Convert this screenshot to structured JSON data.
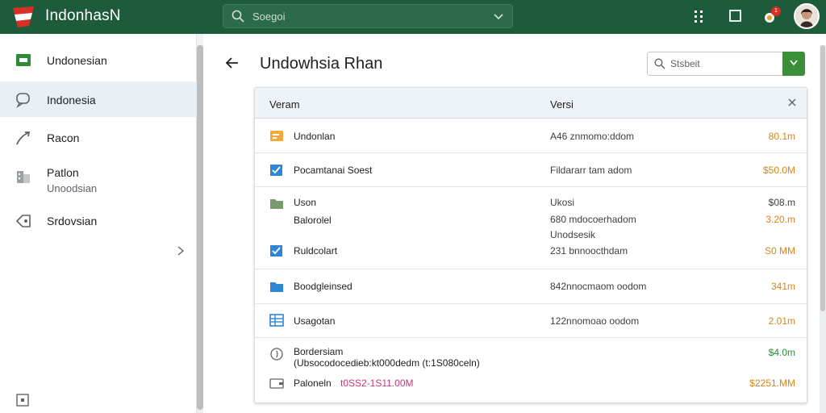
{
  "app": {
    "brand": "IndonhasN"
  },
  "search": {
    "placeholder": "Soegoi"
  },
  "topbar": {
    "notification_count": "1"
  },
  "sidebar": {
    "items": [
      {
        "label": "Undonesian",
        "icon": "green-square-icon"
      },
      {
        "label": "Indonesia",
        "icon": "chat-bubble-icon"
      },
      {
        "label": "Racon",
        "icon": "trend-arrow-icon"
      },
      {
        "label": "Patlon",
        "sub": "Unoodsian",
        "icon": "building-icon"
      },
      {
        "label": "Srdovsian",
        "icon": "tag-icon"
      }
    ]
  },
  "main": {
    "title": "Undowhsia Rhan",
    "filter": {
      "placeholder": "Stsbeit"
    },
    "table": {
      "headers": [
        "Veram",
        "Versi"
      ],
      "rows": [
        {
          "name": "Undonlan",
          "desc": "A46 znmomo:ddom",
          "amount": "80.1m",
          "amount_color": "orange",
          "icon": "folder-orange-icon"
        },
        {
          "name": "Pocamtanai Soest",
          "desc": "Fildararr tam adom",
          "amount": "$50.0M",
          "amount_color": "orange",
          "icon": "checkbox-blue-icon"
        },
        {
          "name": "Uson",
          "name2": "Balorolel",
          "desc": "Ukosi",
          "desc2": "680 mdocoerhadom",
          "desc3": "Unodsesik",
          "amount": "$08.m",
          "amount2": "3.20.m",
          "amount_color": "gray",
          "amount2_color": "orange",
          "icon": "folder-green-icon"
        },
        {
          "name": "Ruldcolart",
          "desc": "231 bnnoocthdam",
          "amount": "S0 MM",
          "amount_color": "orange",
          "icon": "checkbox-blue-icon"
        },
        {
          "name": "Boodgleinsed",
          "desc": "842nnocmaom oodom",
          "amount": "341m",
          "amount_color": "orange",
          "icon": "folder-blue-icon"
        },
        {
          "name": "Usagotan",
          "desc": "122nnomoao oodom",
          "amount": "2.01m",
          "amount_color": "orange",
          "icon": "grid-blue-icon"
        },
        {
          "name": "Bordersiam",
          "note": "(Ubsocodocedieb:kt000dedm (t:1S080celn)",
          "amount": "$4.0m",
          "amount_color": "green",
          "icon": "compass-icon"
        },
        {
          "name": "Paloneln",
          "note": "t0SS2-1S11.00M",
          "amount": "$2251.MM",
          "amount_color": "orange",
          "icon": "card-icon"
        }
      ]
    }
  },
  "colors": {
    "topbar": "#1e5b3c",
    "accent_green": "#3c8f3a",
    "amount_orange": "#d9841c",
    "amount_green": "#2e8b3a",
    "note_pink": "#c8347a"
  }
}
